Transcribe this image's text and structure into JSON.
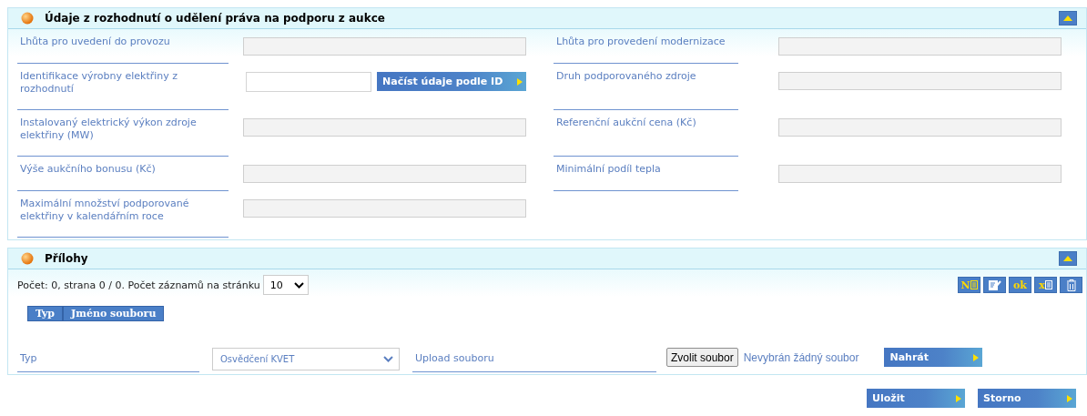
{
  "sections": [
    {
      "title": "Údaje z rozhodnutí o udělení práva na podporu z aukce",
      "expanded": true,
      "left_fields": [
        {
          "kind": "readonly",
          "label": "Lhůta pro uvedení do provozu"
        },
        {
          "kind": "input_button",
          "label": "Identifikace výrobny elektřiny z rozhodnutí",
          "button": "Načíst údaje podle ID"
        },
        {
          "kind": "readonly",
          "label": "Instalovaný elektrický výkon zdroje elektřiny (MW)"
        },
        {
          "kind": "readonly",
          "label": "Výše aukčního bonusu (Kč)"
        },
        {
          "kind": "readonly",
          "label": "Maximální množství podporované elektřiny v kalendářním roce"
        }
      ],
      "right_fields": [
        {
          "kind": "readonly",
          "label": "Lhůta pro provedení modernizace"
        },
        {
          "kind": "readonly",
          "label": "Druh podporovaného zdroje"
        },
        {
          "kind": "readonly",
          "label": "Referenční aukční cena (Kč)"
        },
        {
          "kind": "readonly",
          "label": "Minimální podíl tepla"
        }
      ]
    },
    {
      "title": "Přílohy",
      "expanded": true
    }
  ],
  "attachments": {
    "pager": "Počet: 0, strana 0 / 0. Počet záznamů na stránku",
    "page_size": "10",
    "toolbar": [
      {
        "kind": "new",
        "glyph": "N"
      },
      {
        "kind": "edit"
      },
      {
        "kind": "ok",
        "glyph": "ok"
      },
      {
        "kind": "export",
        "glyph": "x"
      },
      {
        "kind": "delete"
      }
    ],
    "columns": [
      "Typ",
      "Jméno souboru"
    ],
    "type_label": "Typ",
    "type_value": "Osvědčení KVET",
    "upload_label": "Upload souboru",
    "choose_button": "Zvolit soubor",
    "no_file": "Nevybrán žádný soubor",
    "upload_button": "Nahrát"
  },
  "buttons": [
    "Uložit",
    "Storno"
  ]
}
